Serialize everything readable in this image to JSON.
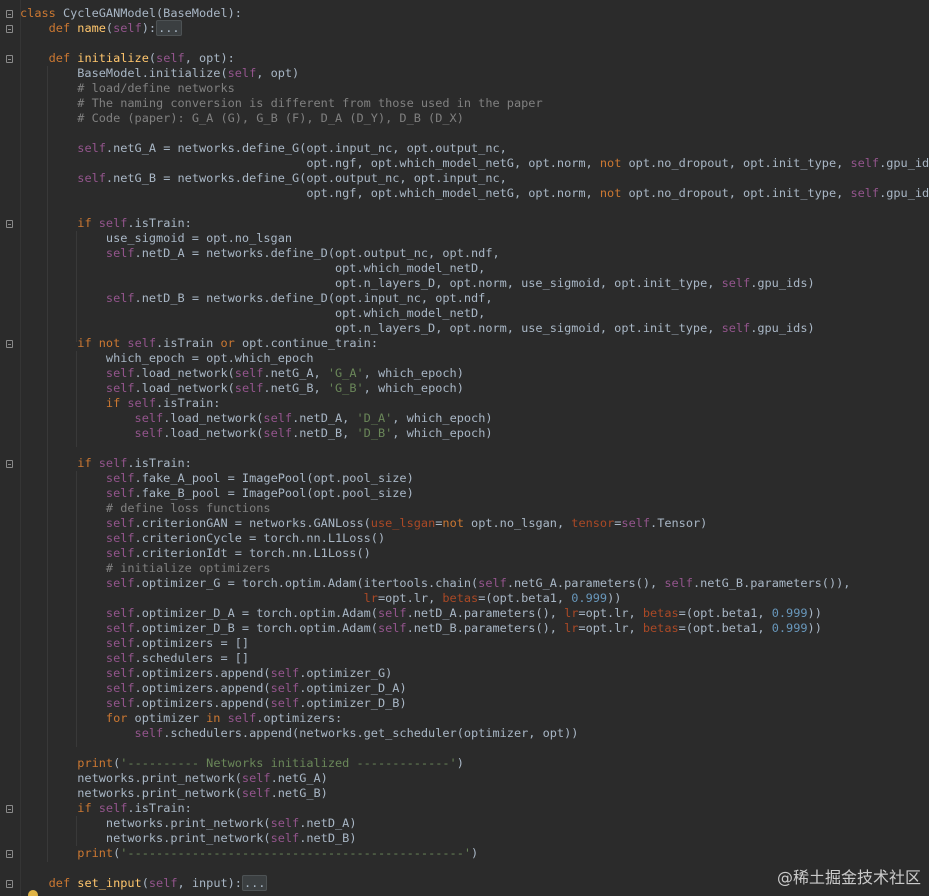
{
  "editor": {
    "theme": "darcula",
    "colors": {
      "background": "#2b2b2b",
      "default": "#a9b7c6",
      "keyword": "#cc7832",
      "function": "#ffc66d",
      "self": "#94558d",
      "string": "#6a8759",
      "number": "#6897bb",
      "comment": "#808080",
      "param_name": "#aa4926"
    },
    "lines": [
      [
        [
          "kw",
          "class "
        ],
        [
          "",
          "CycleGANModel(BaseModel):"
        ]
      ],
      [
        [
          "",
          "    "
        ],
        [
          "kw",
          "def "
        ],
        [
          "fn",
          "name"
        ],
        [
          "",
          "("
        ],
        [
          "sf",
          "self"
        ],
        [
          "",
          "):"
        ],
        [
          "coll",
          "..."
        ]
      ],
      [
        [
          "",
          ""
        ]
      ],
      [
        [
          "",
          "    "
        ],
        [
          "kw",
          "def "
        ],
        [
          "fn",
          "initialize"
        ],
        [
          "",
          "("
        ],
        [
          "sf",
          "self"
        ],
        [
          "",
          ", opt):"
        ]
      ],
      [
        [
          "",
          "        BaseModel.initialize("
        ],
        [
          "sf",
          "self"
        ],
        [
          "",
          ", opt)"
        ]
      ],
      [
        [
          "",
          "        "
        ],
        [
          "cm",
          "# load/define networks"
        ]
      ],
      [
        [
          "",
          "        "
        ],
        [
          "cm",
          "# The naming conversion is different from those used in the paper"
        ]
      ],
      [
        [
          "",
          "        "
        ],
        [
          "cm",
          "# Code (paper): G_A (G), G_B (F), D_A (D_Y), D_B (D_X)"
        ]
      ],
      [
        [
          "",
          ""
        ]
      ],
      [
        [
          "",
          "        "
        ],
        [
          "sf",
          "self"
        ],
        [
          "",
          ".netG_A = networks.define_G(opt.input_nc, opt.output_nc,"
        ]
      ],
      [
        [
          "",
          "                                        opt.ngf, opt.which_model_netG, opt.norm, "
        ],
        [
          "kw",
          "not "
        ],
        [
          "",
          "opt.no_dropout, opt.init_type, "
        ],
        [
          "sf",
          "self"
        ],
        [
          "",
          ".gpu_ids)"
        ]
      ],
      [
        [
          "",
          "        "
        ],
        [
          "sf",
          "self"
        ],
        [
          "",
          ".netG_B = networks.define_G(opt.output_nc, opt.input_nc,"
        ]
      ],
      [
        [
          "",
          "                                        opt.ngf, opt.which_model_netG, opt.norm, "
        ],
        [
          "kw",
          "not "
        ],
        [
          "",
          "opt.no_dropout, opt.init_type, "
        ],
        [
          "sf",
          "self"
        ],
        [
          "",
          ".gpu_ids)"
        ]
      ],
      [
        [
          "",
          ""
        ]
      ],
      [
        [
          "",
          "        "
        ],
        [
          "kw",
          "if "
        ],
        [
          "sf",
          "self"
        ],
        [
          "",
          ".isTrain:"
        ]
      ],
      [
        [
          "",
          "            use_sigmoid = opt.no_lsgan"
        ]
      ],
      [
        [
          "",
          "            "
        ],
        [
          "sf",
          "self"
        ],
        [
          "",
          ".netD_A = networks.define_D(opt.output_nc, opt.ndf,"
        ]
      ],
      [
        [
          "",
          "                                            opt.which_model_netD,"
        ]
      ],
      [
        [
          "",
          "                                            opt.n_layers_D, opt.norm, use_sigmoid, opt.init_type, "
        ],
        [
          "sf",
          "self"
        ],
        [
          "",
          ".gpu_ids)"
        ]
      ],
      [
        [
          "",
          "            "
        ],
        [
          "sf",
          "self"
        ],
        [
          "",
          ".netD_B = networks.define_D(opt.input_nc, opt.ndf,"
        ]
      ],
      [
        [
          "",
          "                                            opt.which_model_netD,"
        ]
      ],
      [
        [
          "",
          "                                            opt.n_layers_D, opt.norm, use_sigmoid, opt.init_type, "
        ],
        [
          "sf",
          "self"
        ],
        [
          "",
          ".gpu_ids)"
        ]
      ],
      [
        [
          "",
          "        "
        ],
        [
          "kw",
          "if not "
        ],
        [
          "sf",
          "self"
        ],
        [
          "",
          ".isTrain "
        ],
        [
          "kw",
          "or "
        ],
        [
          "",
          "opt.continue_train:"
        ]
      ],
      [
        [
          "",
          "            which_epoch = opt.which_epoch"
        ]
      ],
      [
        [
          "",
          "            "
        ],
        [
          "sf",
          "self"
        ],
        [
          "",
          ".load_network("
        ],
        [
          "sf",
          "self"
        ],
        [
          "",
          ".netG_A, "
        ],
        [
          "st",
          "'G_A'"
        ],
        [
          "",
          ", which_epoch)"
        ]
      ],
      [
        [
          "",
          "            "
        ],
        [
          "sf",
          "self"
        ],
        [
          "",
          ".load_network("
        ],
        [
          "sf",
          "self"
        ],
        [
          "",
          ".netG_B, "
        ],
        [
          "st",
          "'G_B'"
        ],
        [
          "",
          ", which_epoch)"
        ]
      ],
      [
        [
          "",
          "            "
        ],
        [
          "kw",
          "if "
        ],
        [
          "sf",
          "self"
        ],
        [
          "",
          ".isTrain:"
        ]
      ],
      [
        [
          "",
          "                "
        ],
        [
          "sf",
          "self"
        ],
        [
          "",
          ".load_network("
        ],
        [
          "sf",
          "self"
        ],
        [
          "",
          ".netD_A, "
        ],
        [
          "st",
          "'D_A'"
        ],
        [
          "",
          ", which_epoch)"
        ]
      ],
      [
        [
          "",
          "                "
        ],
        [
          "sf",
          "self"
        ],
        [
          "",
          ".load_network("
        ],
        [
          "sf",
          "self"
        ],
        [
          "",
          ".netD_B, "
        ],
        [
          "st",
          "'D_B'"
        ],
        [
          "",
          ", which_epoch)"
        ]
      ],
      [
        [
          "",
          ""
        ]
      ],
      [
        [
          "",
          "        "
        ],
        [
          "kw",
          "if "
        ],
        [
          "sf",
          "self"
        ],
        [
          "",
          ".isTrain:"
        ]
      ],
      [
        [
          "",
          "            "
        ],
        [
          "sf",
          "self"
        ],
        [
          "",
          ".fake_A_pool = ImagePool(opt.pool_size)"
        ]
      ],
      [
        [
          "",
          "            "
        ],
        [
          "sf",
          "self"
        ],
        [
          "",
          ".fake_B_pool = ImagePool(opt.pool_size)"
        ]
      ],
      [
        [
          "",
          "            "
        ],
        [
          "cm",
          "# define loss functions"
        ]
      ],
      [
        [
          "",
          "            "
        ],
        [
          "sf",
          "self"
        ],
        [
          "",
          ".criterionGAN = networks.GANLoss("
        ],
        [
          "pn",
          "use_lsgan"
        ],
        [
          "",
          "="
        ],
        [
          "kw",
          "not "
        ],
        [
          "",
          "opt.no_lsgan, "
        ],
        [
          "pn",
          "tensor"
        ],
        [
          "",
          "="
        ],
        [
          "sf",
          "self"
        ],
        [
          "",
          ".Tensor)"
        ]
      ],
      [
        [
          "",
          "            "
        ],
        [
          "sf",
          "self"
        ],
        [
          "",
          ".criterionCycle = torch.nn.L1Loss()"
        ]
      ],
      [
        [
          "",
          "            "
        ],
        [
          "sf",
          "self"
        ],
        [
          "",
          ".criterionIdt = torch.nn.L1Loss()"
        ]
      ],
      [
        [
          "",
          "            "
        ],
        [
          "cm",
          "# initialize optimizers"
        ]
      ],
      [
        [
          "",
          "            "
        ],
        [
          "sf",
          "self"
        ],
        [
          "",
          ".optimizer_G = torch.optim.Adam(itertools.chain("
        ],
        [
          "sf",
          "self"
        ],
        [
          "",
          ".netG_A.parameters(), "
        ],
        [
          "sf",
          "self"
        ],
        [
          "",
          ".netG_B.parameters()),"
        ]
      ],
      [
        [
          "",
          "                                                "
        ],
        [
          "pn",
          "lr"
        ],
        [
          "",
          "=opt.lr, "
        ],
        [
          "pn",
          "betas"
        ],
        [
          "",
          "=(opt.beta1, "
        ],
        [
          "nu",
          "0.999"
        ],
        [
          "",
          "))"
        ]
      ],
      [
        [
          "",
          "            "
        ],
        [
          "sf",
          "self"
        ],
        [
          "",
          ".optimizer_D_A = torch.optim.Adam("
        ],
        [
          "sf",
          "self"
        ],
        [
          "",
          ".netD_A.parameters(), "
        ],
        [
          "pn",
          "lr"
        ],
        [
          "",
          "=opt.lr, "
        ],
        [
          "pn",
          "betas"
        ],
        [
          "",
          "=(opt.beta1, "
        ],
        [
          "nu",
          "0.999"
        ],
        [
          "",
          "))"
        ]
      ],
      [
        [
          "",
          "            "
        ],
        [
          "sf",
          "self"
        ],
        [
          "",
          ".optimizer_D_B = torch.optim.Adam("
        ],
        [
          "sf",
          "self"
        ],
        [
          "",
          ".netD_B.parameters(), "
        ],
        [
          "pn",
          "lr"
        ],
        [
          "",
          "=opt.lr, "
        ],
        [
          "pn",
          "betas"
        ],
        [
          "",
          "=(opt.beta1, "
        ],
        [
          "nu",
          "0.999"
        ],
        [
          "",
          "))"
        ]
      ],
      [
        [
          "",
          "            "
        ],
        [
          "sf",
          "self"
        ],
        [
          "",
          ".optimizers = []"
        ]
      ],
      [
        [
          "",
          "            "
        ],
        [
          "sf",
          "self"
        ],
        [
          "",
          ".schedulers = []"
        ]
      ],
      [
        [
          "",
          "            "
        ],
        [
          "sf",
          "self"
        ],
        [
          "",
          ".optimizers.append("
        ],
        [
          "sf",
          "self"
        ],
        [
          "",
          ".optimizer_G)"
        ]
      ],
      [
        [
          "",
          "            "
        ],
        [
          "sf",
          "self"
        ],
        [
          "",
          ".optimizers.append("
        ],
        [
          "sf",
          "self"
        ],
        [
          "",
          ".optimizer_D_A)"
        ]
      ],
      [
        [
          "",
          "            "
        ],
        [
          "sf",
          "self"
        ],
        [
          "",
          ".optimizers.append("
        ],
        [
          "sf",
          "self"
        ],
        [
          "",
          ".optimizer_D_B)"
        ]
      ],
      [
        [
          "",
          "            "
        ],
        [
          "kw",
          "for "
        ],
        [
          "",
          "optimizer "
        ],
        [
          "kw",
          "in "
        ],
        [
          "sf",
          "self"
        ],
        [
          "",
          ".optimizers:"
        ]
      ],
      [
        [
          "",
          "                "
        ],
        [
          "sf",
          "self"
        ],
        [
          "",
          ".schedulers.append(networks.get_scheduler(optimizer, opt))"
        ]
      ],
      [
        [
          "",
          ""
        ]
      ],
      [
        [
          "",
          "        "
        ],
        [
          "kw",
          "print"
        ],
        [
          "",
          "("
        ],
        [
          "st",
          "'---------- Networks initialized -------------'"
        ],
        [
          "",
          ")"
        ]
      ],
      [
        [
          "",
          "        networks.print_network("
        ],
        [
          "sf",
          "self"
        ],
        [
          "",
          ".netG_A)"
        ]
      ],
      [
        [
          "",
          "        networks.print_network("
        ],
        [
          "sf",
          "self"
        ],
        [
          "",
          ".netG_B)"
        ]
      ],
      [
        [
          "",
          "        "
        ],
        [
          "kw",
          "if "
        ],
        [
          "sf",
          "self"
        ],
        [
          "",
          ".isTrain:"
        ]
      ],
      [
        [
          "",
          "            networks.print_network("
        ],
        [
          "sf",
          "self"
        ],
        [
          "",
          ".netD_A)"
        ]
      ],
      [
        [
          "",
          "            networks.print_network("
        ],
        [
          "sf",
          "self"
        ],
        [
          "",
          ".netD_B)"
        ]
      ],
      [
        [
          "",
          "        "
        ],
        [
          "kw",
          "print"
        ],
        [
          "",
          "("
        ],
        [
          "st",
          "'-----------------------------------------------'"
        ],
        [
          "",
          ")"
        ]
      ],
      [
        [
          "",
          ""
        ]
      ],
      [
        [
          "",
          "    "
        ],
        [
          "kw",
          "def "
        ],
        [
          "fn",
          "set_input"
        ],
        [
          "",
          "("
        ],
        [
          "sf",
          "self"
        ],
        [
          "",
          ", input):"
        ],
        [
          "coll",
          "..."
        ]
      ]
    ]
  },
  "watermark": "@稀土掘金技术社区"
}
